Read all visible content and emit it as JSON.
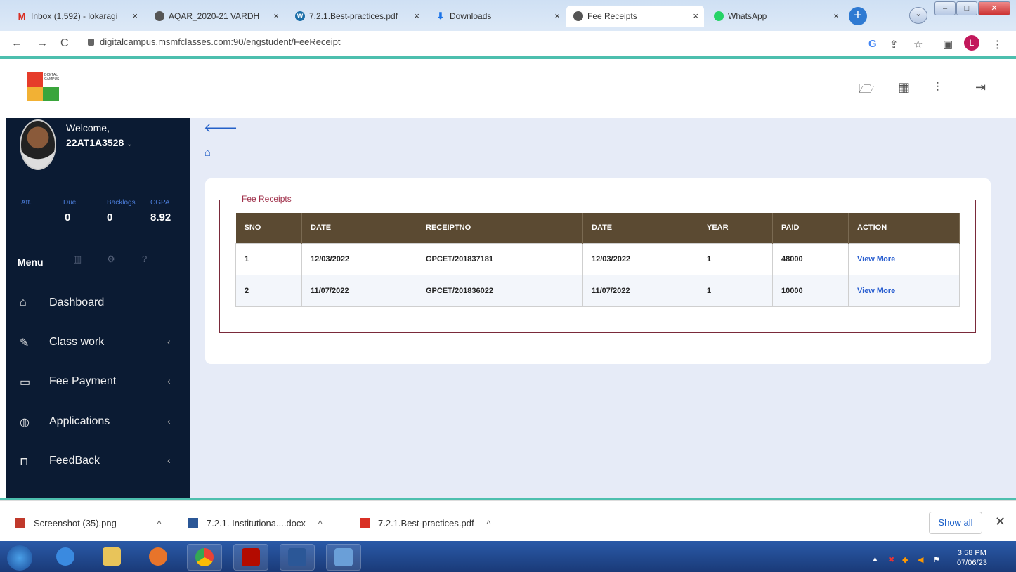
{
  "browser": {
    "tabs": [
      {
        "label": "Inbox (1,592) - lokaragi",
        "icon": "gmail-icon",
        "color": "#d93025"
      },
      {
        "label": "AQAR_2020-21 VARDH",
        "icon": "globe-icon",
        "color": "#555555"
      },
      {
        "label": "7.2.1.Best-practices.pdf",
        "icon": "wordpress-icon",
        "color": "#1b6ea8"
      },
      {
        "label": "Downloads",
        "icon": "download-icon",
        "color": "#1a73e8"
      },
      {
        "label": "Fee Receipts",
        "icon": "globe-icon",
        "color": "#555555"
      },
      {
        "label": "WhatsApp",
        "icon": "whatsapp-icon",
        "color": "#25d366"
      }
    ],
    "url": "digitalcampus.msmfclasses.com:90/engstudent/FeeReceipt",
    "profile_initial": "L"
  },
  "header": {
    "logo_text": "DIGITAL CAMPUS"
  },
  "sidebar": {
    "welcome": "Welcome,",
    "user_id": "22AT1A3528",
    "stats": [
      {
        "label": "Att.",
        "value": ""
      },
      {
        "label": "Due",
        "value": "0"
      },
      {
        "label": "Backlogs",
        "value": "0"
      },
      {
        "label": "CGPA",
        "value": "8.92"
      }
    ],
    "menu_tab": "Menu",
    "items": [
      {
        "label": "Dashboard",
        "icon": "home-icon",
        "has_children": false
      },
      {
        "label": "Class work",
        "icon": "pencil-icon",
        "has_children": true
      },
      {
        "label": "Fee Payment",
        "icon": "folder-icon",
        "has_children": true
      },
      {
        "label": "Applications",
        "icon": "globe-icon",
        "has_children": true
      },
      {
        "label": "FeedBack",
        "icon": "lock-icon",
        "has_children": true
      }
    ]
  },
  "main": {
    "section_title": "Fee Receipts",
    "table": {
      "headers": [
        "SNO",
        "DATE",
        "RECEIPTNO",
        "DATE",
        "YEAR",
        "PAID",
        "ACTION"
      ],
      "rows": [
        [
          "1",
          "12/03/2022",
          "GPCET/201837181",
          "12/03/2022",
          "1",
          "48000",
          "View More"
        ],
        [
          "2",
          "11/07/2022",
          "GPCET/201836022",
          "11/07/2022",
          "1",
          "10000",
          "View More"
        ]
      ]
    }
  },
  "downloads": {
    "items": [
      {
        "label": "Screenshot (35).png",
        "icon": "image-file-icon"
      },
      {
        "label": "7.2.1. Institutiona....docx",
        "icon": "word-file-icon"
      },
      {
        "label": "7.2.1.Best-practices.pdf",
        "icon": "pdf-file-icon"
      }
    ],
    "show_all": "Show all"
  },
  "taskbar": {
    "time": "3:58 PM",
    "date": "07/06/23"
  }
}
